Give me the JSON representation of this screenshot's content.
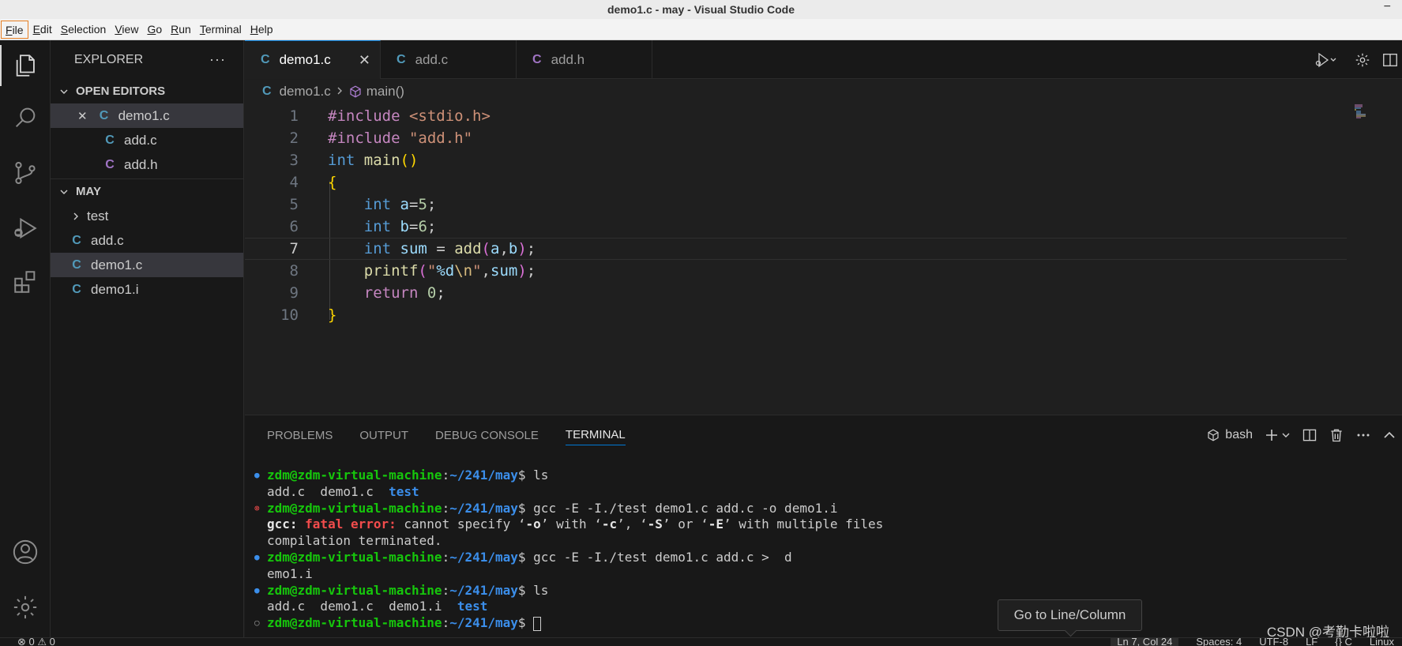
{
  "window": {
    "title": "demo1.c - may - Visual Studio Code",
    "close_glyph": "−"
  },
  "menu": {
    "items": [
      {
        "mnemonic": "F",
        "rest": "ile"
      },
      {
        "mnemonic": "E",
        "rest": "dit"
      },
      {
        "mnemonic": "S",
        "rest": "election"
      },
      {
        "mnemonic": "V",
        "rest": "iew"
      },
      {
        "mnemonic": "G",
        "rest": "o"
      },
      {
        "mnemonic": "R",
        "rest": "un"
      },
      {
        "mnemonic": "T",
        "rest": "erminal"
      },
      {
        "mnemonic": "H",
        "rest": "elp"
      }
    ]
  },
  "sidebar": {
    "title": "EXPLORER",
    "more": "···",
    "open_editors": {
      "label": "OPEN EDITORS",
      "items": [
        {
          "icon": "C",
          "name": "demo1.c",
          "close": "✕"
        },
        {
          "icon": "C",
          "name": "add.c"
        },
        {
          "icon": "C",
          "name": "add.h"
        }
      ]
    },
    "workspace": {
      "label": "MAY",
      "folder": "test",
      "files": [
        {
          "icon": "C",
          "name": "add.c"
        },
        {
          "icon": "C",
          "name": "demo1.c"
        },
        {
          "icon": "C",
          "name": "demo1.i"
        }
      ]
    }
  },
  "tabs": [
    {
      "icon": "C",
      "label": "demo1.c",
      "close": "✕"
    },
    {
      "icon": "C",
      "label": "add.c"
    },
    {
      "icon": "C",
      "label": "add.h"
    }
  ],
  "breadcrumb": {
    "icon": "C",
    "file": "demo1.c",
    "symbol": "main()"
  },
  "editor": {
    "line_numbers": [
      "1",
      "2",
      "3",
      "4",
      "5",
      "6",
      "7",
      "8",
      "9",
      "10"
    ],
    "current_line": "7",
    "code": {
      "l1_directive": "#include",
      "l1_header": "<stdio.h>",
      "l2_directive": "#include",
      "l2_header": "\"add.h\"",
      "l3_type": "int",
      "l3_func": "main",
      "l3_parens": "()",
      "l4_brace": "{",
      "l5_type": "int",
      "l5_var": "a",
      "l5_op": "=",
      "l5_num": "5",
      "l5_semi": ";",
      "l6_type": "int",
      "l6_var": "b",
      "l6_op": "=",
      "l6_num": "6",
      "l6_semi": ";",
      "l7_type": "int",
      "l7_var": "sum",
      "l7_op": " = ",
      "l7_func": "add",
      "l7_open": "(",
      "l7_a": "a",
      "l7_comma": ",",
      "l7_b": "b",
      "l7_close": ")",
      "l7_semi": ";",
      "l8_func": "printf",
      "l8_open": "(",
      "l8_str_start": "\"",
      "l8_fmt": "%d",
      "l8_esc": "\\n",
      "l8_str_end": "\"",
      "l8_comma": ",",
      "l8_var": "sum",
      "l8_close": ")",
      "l8_semi": ";",
      "l9_kw": "return",
      "l9_num": "0",
      "l9_semi": ";",
      "l10_brace": "}"
    }
  },
  "panel": {
    "tabs": [
      "PROBLEMS",
      "OUTPUT",
      "DEBUG CONSOLE",
      "TERMINAL"
    ],
    "active_tab": "TERMINAL",
    "shell": "bash",
    "terminal": {
      "prompt_user": "zdm@zdm-virtual-machine",
      "prompt_sep": ":",
      "prompt_path": "~/241/may",
      "prompt_end": "$ ",
      "cmd1": "ls",
      "out1_files": "add.c  demo1.c  ",
      "out1_dir": "test",
      "cmd2": "gcc -E -I./test demo1.c add.c -o demo1.i",
      "err_prog": "gcc:",
      "err_label": " fatal error:",
      "err_msg_a": " cannot specify ‘",
      "err_o": "-o",
      "err_msg_b": "’ with ‘",
      "err_c": "-c",
      "err_msg_c": "’, ‘",
      "err_s": "-S",
      "err_msg_d": "’ or ‘",
      "err_e": "-E",
      "err_msg_e": "’ with multiple files",
      "err_line2": "compilation terminated.",
      "cmd3": "gcc -E -I./test demo1.c add.c >  d",
      "out3": "emo1.i",
      "cmd4": "ls",
      "out4_files": "add.c  demo1.c  demo1.i  ",
      "out4_dir": "test"
    }
  },
  "tooltip": "Go to Line/Column",
  "watermark": "CSDN @考勤卡啦啦",
  "statusbar": {
    "left": "⊗ 0 ⚠ 0",
    "right": [
      "Ln 7, Col 24",
      "Spaces: 4",
      "UTF-8",
      "LF",
      "{} C",
      "Linux"
    ]
  },
  "colors": {
    "accent": "#0078d4",
    "c_icon_blue": "#519aba",
    "h_icon_purple": "#a074c4",
    "prompt_green": "#16c60c",
    "prompt_blue": "#3b8eea",
    "error_red": "#f14c4c"
  }
}
